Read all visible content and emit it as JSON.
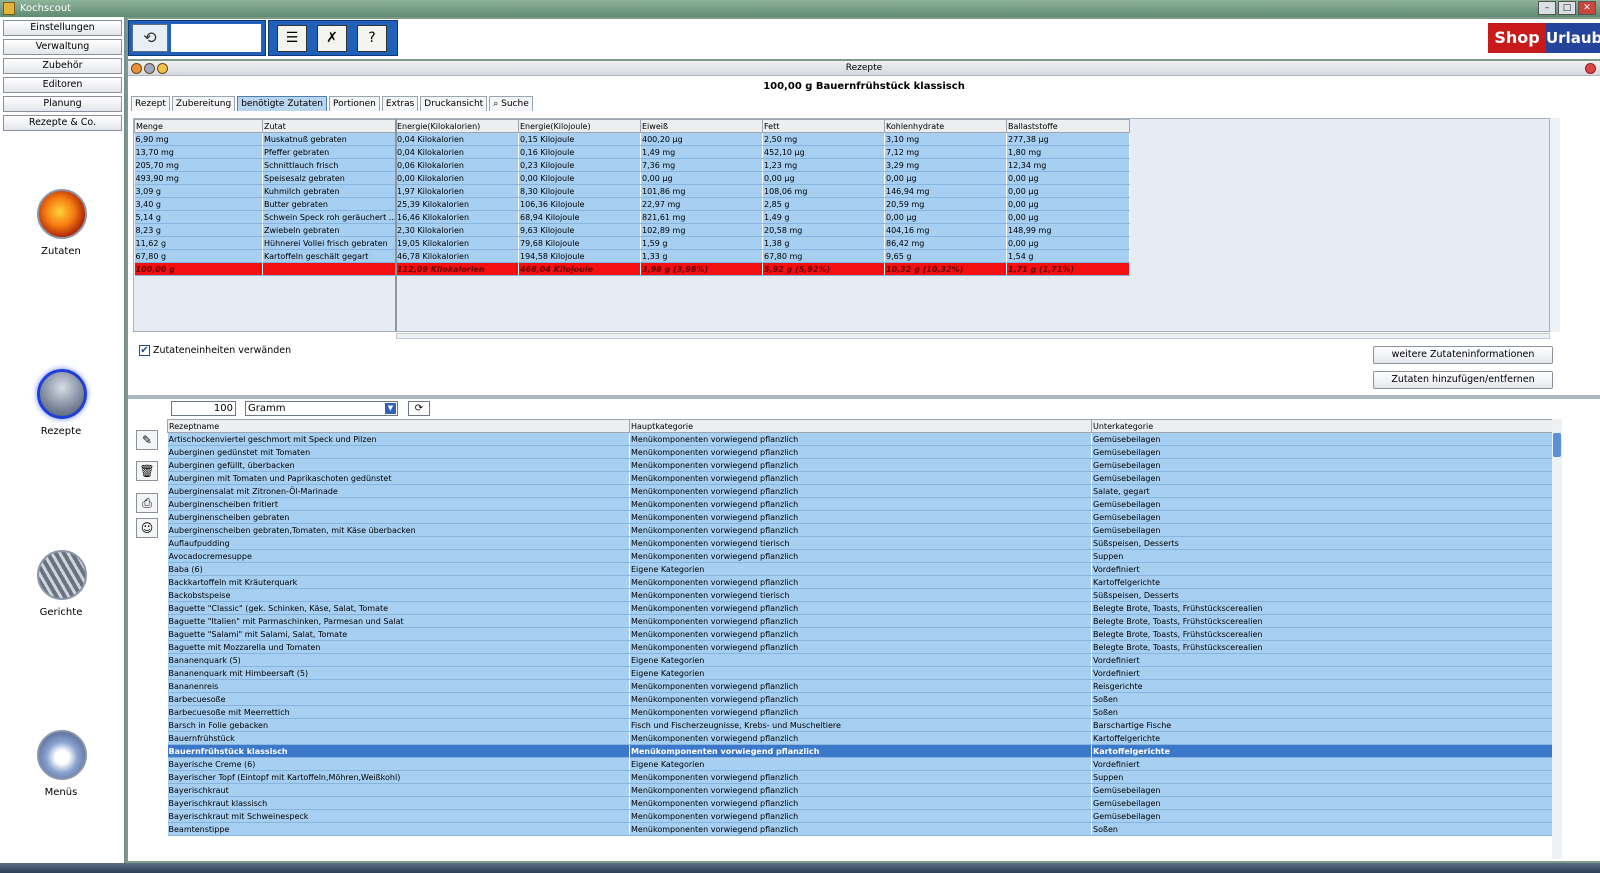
{
  "window": {
    "title": "Kochscout"
  },
  "left_nav": {
    "buttons": [
      "Einstellungen",
      "Verwaltung",
      "Zubehör",
      "Editoren",
      "Planung",
      "Rezepte & Co."
    ],
    "big_icons": [
      {
        "label": "Zutaten",
        "icon": "fire-icon"
      },
      {
        "label": "Rezepte",
        "icon": "plate-icon"
      },
      {
        "label": "Gerichte",
        "icon": "grill-icon"
      },
      {
        "label": "Menüs",
        "icon": "menu-plate-icon"
      }
    ]
  },
  "toolbar": {
    "shop": "Shop",
    "urlaub": "Urlaub"
  },
  "panel": {
    "title": "Rezepte",
    "content_title": "100,00 g  Bauernfrühstück klassisch",
    "tabs": [
      "Rezept",
      "Zubereitung",
      "benötigte Zutaten",
      "Portionen",
      "Extras",
      "Druckansicht",
      "Suche"
    ],
    "active_tab": "benötigte Zutaten"
  },
  "nutrition": {
    "columns": [
      "Menge",
      "Zutat",
      "Energie(Kilokalorien)",
      "Energie(Kilojoule)",
      "Eiweiß",
      "Fett",
      "Kohlenhydrate",
      "Ballaststoffe"
    ],
    "rows": [
      [
        "6,90 mg",
        "Muskatnuß gebraten",
        "0,04 Kilokalorien",
        "0,15 Kilojoule",
        "400,20 µg",
        "2,50 mg",
        "3,10 mg",
        "277,38 µg"
      ],
      [
        "13,70 mg",
        "Pfeffer gebraten",
        "0,04 Kilokalorien",
        "0,16 Kilojoule",
        "1,49 mg",
        "452,10 µg",
        "7,12 mg",
        "1,80 mg"
      ],
      [
        "205,70 mg",
        "Schnittlauch frisch",
        "0,06 Kilokalorien",
        "0,23 Kilojoule",
        "7,36 mg",
        "1,23 mg",
        "3,29 mg",
        "12,34 mg"
      ],
      [
        "493,90 mg",
        "Speisesalz gebraten",
        "0,00 Kilokalorien",
        "0,00 Kilojoule",
        "0,00 µg",
        "0,00 µg",
        "0,00 µg",
        "0,00 µg"
      ],
      [
        "3,09 g",
        "Kuhmilch gebraten",
        "1,97 Kilokalorien",
        "8,30 Kilojoule",
        "101,86 mg",
        "108,06 mg",
        "146,94 mg",
        "0,00 µg"
      ],
      [
        "3,40 g",
        "Butter gebraten",
        "25,39 Kilokalorien",
        "106,36 Kilojoule",
        "22,97 mg",
        "2,85 g",
        "20,59 mg",
        "0,00 µg"
      ],
      [
        "5,14 g",
        "Schwein Speck roh geräuchert ...",
        "16,46 Kilokalorien",
        "68,94 Kilojoule",
        "821,61 mg",
        "1,49 g",
        "0,00 µg",
        "0,00 µg"
      ],
      [
        "8,23 g",
        "Zwiebeln gebraten",
        "2,30 Kilokalorien",
        "9,63 Kilojoule",
        "102,89 mg",
        "20,58 mg",
        "404,16 mg",
        "148,99 mg"
      ],
      [
        "11,62 g",
        "Hühnerei Vollei frisch gebraten",
        "19,05 Kilokalorien",
        "79,68 Kilojoule",
        "1,59 g",
        "1,38 g",
        "86,42 mg",
        "0,00 µg"
      ],
      [
        "67,80 g",
        "Kartoffeln geschält gegart",
        "46,78 Kilokalorien",
        "194,58 Kilojoule",
        "1,33 g",
        "67,80 mg",
        "9,65 g",
        "1,54 g"
      ]
    ],
    "total": [
      "100,00 g",
      "",
      "112,09 Kilokalorien",
      "468,04 Kilojoule",
      "3,98 g (3,98%)",
      "5,92 g (5,92%)",
      "10,32 g (10,32%)",
      "1,71 g (1,71%)"
    ]
  },
  "options": {
    "checkbox_label": "Zutateneinheiten verwänden",
    "more_info_button": "weitere Zutateninformationen",
    "add_remove_button": "Zutaten hinzufügen/entfernen"
  },
  "filter": {
    "amount": "100",
    "unit": "Gramm"
  },
  "recipes": {
    "columns": [
      "Rezeptname",
      "Hauptkategorie",
      "Unterkategorie"
    ],
    "selected_index": 24,
    "rows": [
      [
        "Artischockenviertel geschmort mit Speck und Pilzen",
        "Menükomponenten vorwiegend pflanzlich",
        "Gemüsebeilagen"
      ],
      [
        "Auberginen gedünstet mit Tomaten",
        "Menükomponenten vorwiegend pflanzlich",
        "Gemüsebeilagen"
      ],
      [
        "Auberginen gefüllt, überbacken",
        "Menükomponenten vorwiegend pflanzlich",
        "Gemüsebeilagen"
      ],
      [
        "Auberginen mit Tomaten und Paprikaschoten gedünstet",
        "Menükomponenten vorwiegend pflanzlich",
        "Gemüsebeilagen"
      ],
      [
        "Auberginensalat mit Zitronen-Öl-Marinade",
        "Menükomponenten vorwiegend pflanzlich",
        "Salate, gegart"
      ],
      [
        "Auberginenscheiben fritiert",
        "Menükomponenten vorwiegend pflanzlich",
        "Gemüsebeilagen"
      ],
      [
        "Auberginenscheiben gebraten",
        "Menükomponenten vorwiegend pflanzlich",
        "Gemüsebeilagen"
      ],
      [
        "Auberginenscheiben gebraten,Tomaten, mit Käse überbacken",
        "Menükomponenten vorwiegend pflanzlich",
        "Gemüsebeilagen"
      ],
      [
        "Auflaufpudding",
        "Menükomponenten vorwiegend tierisch",
        "Süßspeisen, Desserts"
      ],
      [
        "Avocadocremesuppe",
        "Menükomponenten vorwiegend pflanzlich",
        "Suppen"
      ],
      [
        "Baba (6)",
        "Eigene Kategorien",
        "Vordefiniert"
      ],
      [
        "Backkartoffeln mit Kräuterquark",
        "Menükomponenten vorwiegend pflanzlich",
        "Kartoffelgerichte"
      ],
      [
        "Backobstspeise",
        "Menükomponenten vorwiegend tierisch",
        "Süßspeisen, Desserts"
      ],
      [
        "Baguette \"Classic\" (gek. Schinken, Käse, Salat, Tomate",
        "Menükomponenten vorwiegend pflanzlich",
        "Belegte Brote, Toasts, Frühstückscerealien"
      ],
      [
        "Baguette \"Italien\" mit Parmaschinken, Parmesan und Salat",
        "Menükomponenten vorwiegend pflanzlich",
        "Belegte Brote, Toasts, Frühstückscerealien"
      ],
      [
        "Baguette \"Salami\" mit Salami, Salat, Tomate",
        "Menükomponenten vorwiegend pflanzlich",
        "Belegte Brote, Toasts, Frühstückscerealien"
      ],
      [
        "Baguette mit Mozzarella und Tomaten",
        "Menükomponenten vorwiegend pflanzlich",
        "Belegte Brote, Toasts, Frühstückscerealien"
      ],
      [
        "Bananenquark (5)",
        "Eigene Kategorien",
        "Vordefiniert"
      ],
      [
        "Bananenquark mit Himbeersaft (5)",
        "Eigene Kategorien",
        "Vordefiniert"
      ],
      [
        "Bananenreis",
        "Menükomponenten vorwiegend pflanzlich",
        "Reisgerichte"
      ],
      [
        "Barbecuesoße",
        "Menükomponenten vorwiegend pflanzlich",
        "Soßen"
      ],
      [
        "Barbecuesoße mit Meerrettich",
        "Menükomponenten vorwiegend pflanzlich",
        "Soßen"
      ],
      [
        "Barsch in Folie gebacken",
        "Fisch und Fischerzeugnisse, Krebs- und Muscheltiere",
        "Barschartige Fische"
      ],
      [
        "Bauernfrühstück",
        "Menükomponenten vorwiegend pflanzlich",
        "Kartoffelgerichte"
      ],
      [
        "Bauernfrühstück klassisch",
        "Menükomponenten vorwiegend pflanzlich",
        "Kartoffelgerichte"
      ],
      [
        "Bayerische Creme (6)",
        "Eigene Kategorien",
        "Vordefiniert"
      ],
      [
        "Bayerischer Topf (Eintopf mit Kartoffeln,Möhren,Weißkohl)",
        "Menükomponenten vorwiegend pflanzlich",
        "Suppen"
      ],
      [
        "Bayerischkraut",
        "Menükomponenten vorwiegend pflanzlich",
        "Gemüsebeilagen"
      ],
      [
        "Bayerischkraut klassisch",
        "Menükomponenten vorwiegend pflanzlich",
        "Gemüsebeilagen"
      ],
      [
        "Bayerischkraut mit Schweinespeck",
        "Menükomponenten vorwiegend pflanzlich",
        "Gemüsebeilagen"
      ],
      [
        "Beamtenstippe",
        "Menükomponenten vorwiegend pflanzlich",
        "Soßen"
      ]
    ]
  },
  "colors": {
    "accent": "#1f60b8",
    "row": "#a6cff2",
    "total": "#f21010",
    "selected": "#3b78c9"
  }
}
